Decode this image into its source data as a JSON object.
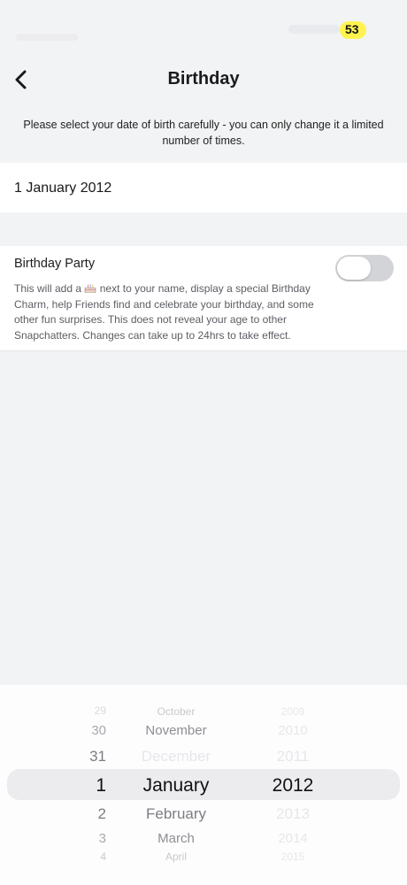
{
  "status_bar": {
    "battery_badge": "53",
    "badge_color": "#FFF44F"
  },
  "header": {
    "title": "Birthday",
    "back_icon": "chevron-left-icon"
  },
  "notice": "Please select your date of birth carefully - you can only change it a limited number of times.",
  "birthday_field": {
    "value": "1 January 2012"
  },
  "birthday_party": {
    "title": "Birthday Party",
    "description_before_icon": "This will add a",
    "description_icon": "birthday-cake-icon",
    "description_after_icon": "next to your name, display a special Birthday Charm, help Friends find and celebrate your birthday, and some other fun surprises. This does not reveal your age to other Snapchatters. Changes can take up to 24hrs to take effect.",
    "toggle_on": false,
    "toggle_off_color": "#D3D4D8"
  },
  "picker": {
    "days": [
      "29",
      "30",
      "31",
      "1",
      "2",
      "3",
      "4"
    ],
    "months": [
      "October",
      "November",
      "December",
      "January",
      "February",
      "March",
      "April"
    ],
    "years": [
      "2009",
      "2010",
      "2011",
      "2012",
      "2013",
      "2014",
      "2015"
    ],
    "selected": {
      "day": "1",
      "month": "January",
      "year": "2012"
    }
  }
}
